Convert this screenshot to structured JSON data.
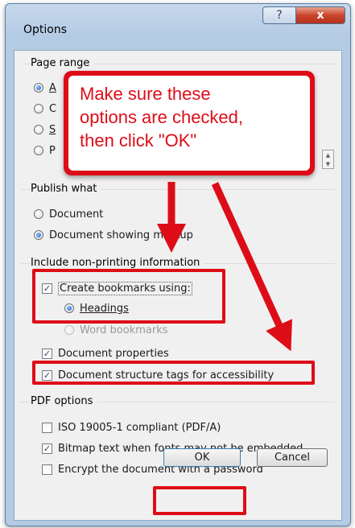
{
  "window": {
    "title": "Options",
    "help_glyph": "?",
    "close_glyph": "x"
  },
  "page_range": {
    "title": "Page range",
    "options": [
      {
        "label": "A",
        "selected": true
      },
      {
        "label": "C",
        "selected": false
      },
      {
        "label": "S",
        "selected": false
      },
      {
        "label": "P",
        "selected": false
      }
    ]
  },
  "publish_what": {
    "title": "Publish what",
    "options": [
      {
        "label": "Document",
        "selected": false
      },
      {
        "label": "Document showing markup",
        "selected": true
      }
    ]
  },
  "non_printing": {
    "title": "Include non-printing information",
    "create_bookmarks": {
      "label": "Create bookmarks using:",
      "checked": true
    },
    "headings": {
      "label": "Headings",
      "selected": true
    },
    "word_bookmarks": {
      "label": "Word bookmarks",
      "enabled": false
    },
    "document_properties": {
      "label": "Document properties",
      "checked": true
    },
    "structure_tags": {
      "label": "Document structure tags for accessibility",
      "checked": true
    }
  },
  "pdf_options": {
    "title": "PDF options",
    "iso": {
      "label": "ISO 19005-1 compliant (PDF/A)",
      "checked": false
    },
    "bitmap": {
      "label": "Bitmap text when fonts may not be embedded",
      "checked": true
    },
    "encrypt": {
      "label": "Encrypt the document with a password",
      "checked": false
    }
  },
  "buttons": {
    "ok": "OK",
    "cancel": "Cancel"
  },
  "annotation": {
    "callout_lines": [
      "Make sure these",
      "options are checked,",
      "then click \"OK\""
    ],
    "color": "#dd0d18"
  },
  "check_glyph": "✓"
}
